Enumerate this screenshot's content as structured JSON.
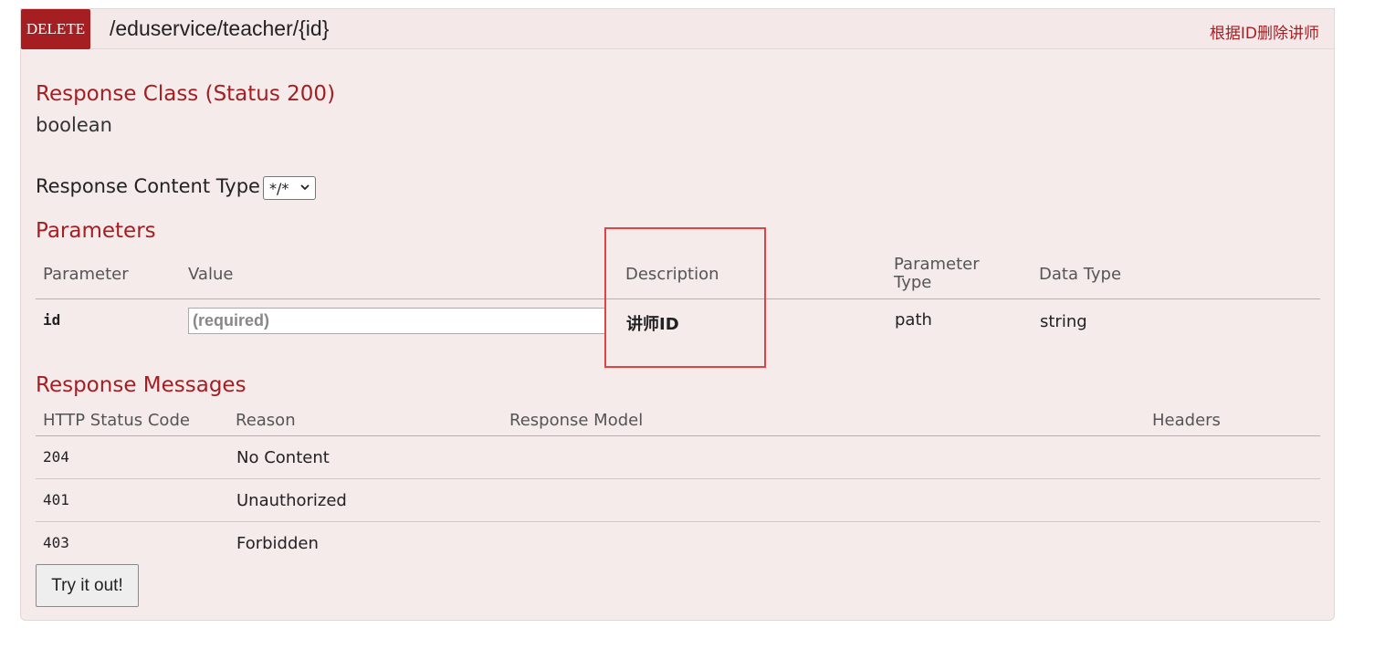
{
  "endpoint": {
    "method": "DELETE",
    "path": "/eduservice/teacher/{id}",
    "summary": "根据ID删除讲师"
  },
  "response_class": {
    "title": "Response Class (Status 200)",
    "type": "boolean"
  },
  "content_type": {
    "label": "Response Content Type",
    "selected": "*/*"
  },
  "parameters": {
    "title": "Parameters",
    "headers": {
      "parameter": "Parameter",
      "value": "Value",
      "description": "Description",
      "parameter_type": "Parameter\nType",
      "data_type": "Data Type"
    },
    "rows": [
      {
        "name": "id",
        "placeholder": "(required)",
        "description": "讲师ID",
        "param_type": "path",
        "data_type": "string"
      }
    ]
  },
  "response_messages": {
    "title": "Response Messages",
    "headers": {
      "status_code": "HTTP Status Code",
      "reason": "Reason",
      "model": "Response Model",
      "headers": "Headers"
    },
    "rows": [
      {
        "code": "204",
        "reason": "No Content"
      },
      {
        "code": "401",
        "reason": "Unauthorized"
      },
      {
        "code": "403",
        "reason": "Forbidden"
      }
    ]
  },
  "try_button": "Try it out!",
  "colors": {
    "method_bg": "#a41e22",
    "accent": "#a41e22",
    "panel_bg": "#f5ebeb",
    "highlight_box": "#e04343"
  }
}
